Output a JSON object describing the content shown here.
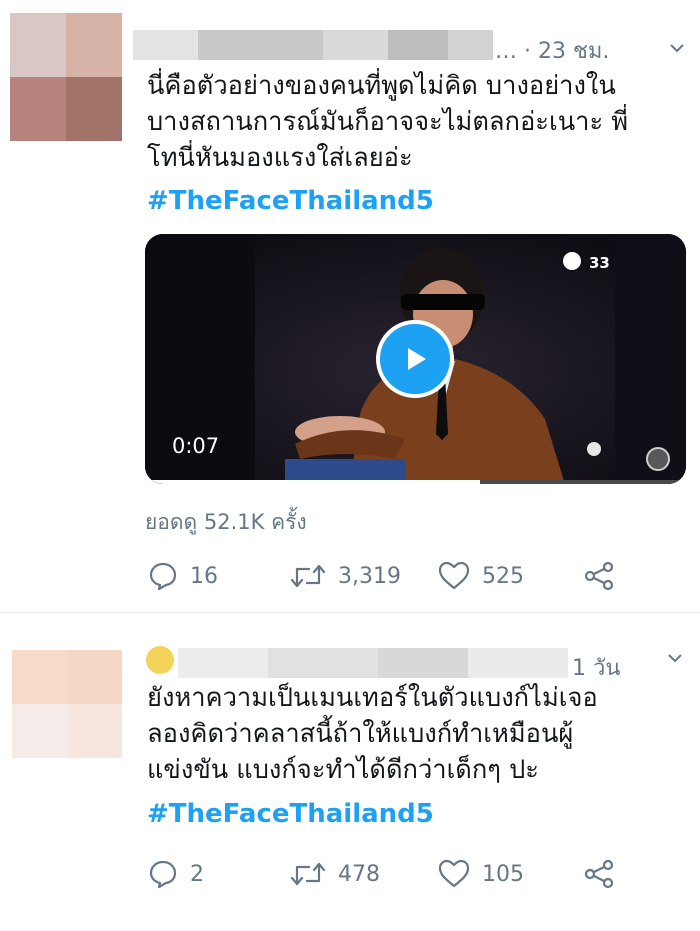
{
  "tweet1": {
    "time": "… · 23 ชม.",
    "text_lines": [
      "นี่คือตัวอย่างของคนที่พูดไม่คิด บางอย่างใน",
      "บางสถานการณ์มันก็อาจจะไม่ตลกอ่ะเนาะ พี่",
      "โทนี่หันมองแรงใส่เลยอ่ะ"
    ],
    "hashtag": "#TheFaceThailand5",
    "video": {
      "duration": "0:07",
      "channel_badge": "33"
    },
    "views": "ยอดดู 52.1K ครั้ง",
    "replies": "16",
    "retweets": "3,319",
    "likes": "525"
  },
  "tweet2": {
    "time": "1 วัน",
    "text_lines": [
      "ยังหาความเป็นเมนเทอร์ในตัวแบงก์ไม่เจอ",
      "ลองคิดว่าคลาสนี้ถ้าให้แบงก์ทำเหมือนผู้",
      "แข่งขัน แบงก์จะทำได้ดีกว่าเด็กๆ ปะ"
    ],
    "hashtag": "#TheFaceThailand5",
    "replies": "2",
    "retweets": "478",
    "likes": "105"
  },
  "colors": {
    "accent": "#1da1f2",
    "muted": "#657786",
    "text": "#14171a",
    "divider": "#e6ecf0"
  },
  "icons": [
    "reply-icon",
    "retweet-icon",
    "like-icon",
    "share-icon",
    "chevron-down-icon",
    "play-icon"
  ]
}
